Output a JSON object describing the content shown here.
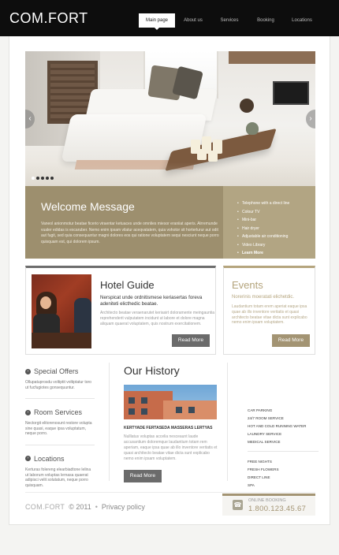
{
  "header": {
    "logo": "COM.FORT",
    "nav": [
      {
        "label": "Main page",
        "active": true
      },
      {
        "label": "About us",
        "active": false
      },
      {
        "label": "Services",
        "active": false
      },
      {
        "label": "Booking",
        "active": false
      },
      {
        "label": "Locations",
        "active": false
      }
    ]
  },
  "slider": {
    "dots": 5,
    "active_dot": 0,
    "prev_icon": "chevron-left-icon",
    "next_icon": "chevron-right-icon"
  },
  "welcome": {
    "title": "Welcome Message",
    "text": "Vaneol anionmotur beatae ficerio viraentar ketuaces unde omnlies miesor eraniiat aperis. Alrremunde vualer edidas is excaruber. Nemo enim ipsam vilatur aceqvatatem, quia vohotor sit horterlurur aut odit aut fugit, sed quia consequuntur magni dolores eos qui ratione voluptatem sequi nesciunt neque porro quisquam est, qui dolorem ipsum.",
    "features": [
      {
        "label": "Telephone with a direct line",
        "bold": false
      },
      {
        "label": "Colour TV",
        "bold": false
      },
      {
        "label": "Mini-bar",
        "bold": false
      },
      {
        "label": "Hair dryer",
        "bold": false
      },
      {
        "label": "Adjustable air conditioning",
        "bold": false
      },
      {
        "label": "Video Library",
        "bold": false
      },
      {
        "label": "Learn More",
        "bold": true
      }
    ]
  },
  "hotel_guide": {
    "title": "Hotel Guide",
    "subtitle": "Nerspicat unde ordnitismese keriasertas foreva adeniteti elicthedic beatae.",
    "text": "Architecto beatae veraenarutet keriasirt doloramente meingauntia reprehenderit vulputatem incidunt ut labore et dolore magna aliquam quaerat voluptatem, quis nostrum exercitationem.",
    "button": "Read More"
  },
  "events": {
    "title": "Events",
    "subtitle": "Norerinis moeratati elichetdic.",
    "text": "Laudantium totam erem aperiat eaque ipsa quae ab illo inventore veritatis et quasi architecto beatae vitae dicta sunt explicabo nemo enim ipsam voluptatem.",
    "button": "Read More"
  },
  "sidebar": [
    {
      "icon": "chevron-right-circle-icon",
      "title": "Special Offers",
      "text": "Ollupatuprosdu voltiptit voltiptatur toro ut fucfugiotes gonsequuntur."
    },
    {
      "icon": "chevron-right-circle-icon",
      "title": "Room Services",
      "text": "Nectorgit elitorenosunt restore volupta sine quasi, eaque ipsa voluptatum, neque porro."
    },
    {
      "icon": "chevron-right-circle-icon",
      "title": "Locations",
      "text": "Kerturas folereng elearbiadtone lelina ut laborum voluptas lernasa quaerat adipisci velit solutatum, neque porro quisquam."
    }
  ],
  "history": {
    "title": "Our History",
    "caption": "KERTYADE FERTASEDA MASSERAS LERTYAS",
    "text": "Nulllatus voluptas accelia nesceaunt laude accusantium doloremque laudantium totam rem aperiam, eaque ipsa quae ab illo inventore veritatis et quasi architecto beatae vitae dicta sunt explicabo nemo enim ipsam voluptatem.",
    "button": "Read More"
  },
  "amenities": {
    "group1": [
      "CAR PARKING",
      "24/7 ROOM SERVICE",
      "HOT AND COLD RUNNING WATER",
      "LAUNDRY SERVICE",
      "MEDICAL SERVICE"
    ],
    "group2": [
      "FREE NIGHTS",
      "FRESH FLOWERS",
      "DIRECT LINE",
      "SPA"
    ]
  },
  "footer": {
    "logo": "COM.FORT",
    "copyright": "© 2011",
    "separator": "•",
    "privacy": "Privacy policy",
    "booking_label": "ONLINE BOOKING",
    "phone": "1.800.123.45.67",
    "phone_icon": "phone-icon"
  }
}
